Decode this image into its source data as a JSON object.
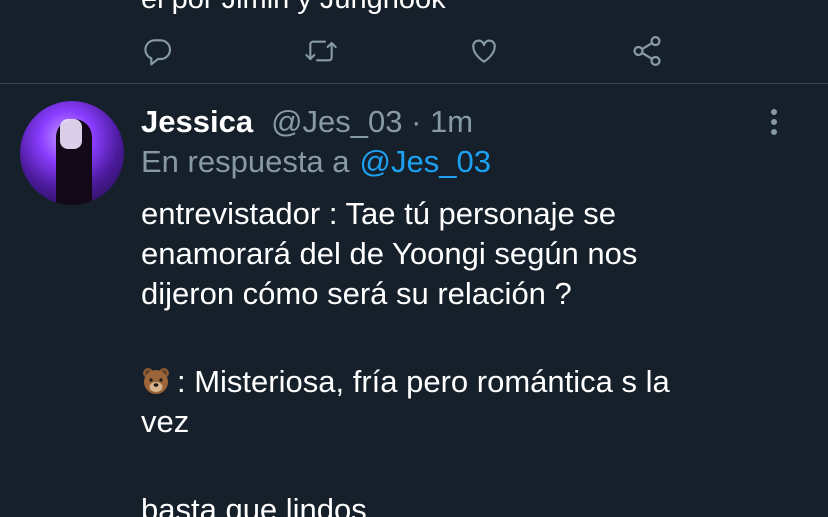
{
  "previous_tweet": {
    "text_partial": "el por Jimin y Junghook"
  },
  "actions": {
    "reply_icon": "reply-icon",
    "retweet_icon": "retweet-icon",
    "like_icon": "heart-icon",
    "share_icon": "share-icon"
  },
  "tweet": {
    "display_name": "Jessica",
    "handle_time": "@Jes_03 · 1m",
    "reply_prefix": "En respuesta a",
    "reply_handle": "@Jes_03",
    "line1": "entrevistador : Tae tú personaje se",
    "line2": "enamorará del de Yoongi según nos",
    "line3": "dijeron cómo será su relación ?",
    "line4": ": Misteriosa, fría pero romántica s la",
    "line5": "vez",
    "line6": "basta que lindos",
    "emoji": "bear-face-emoji",
    "more_icon": "more-vertical-icon"
  },
  "colors": {
    "background": "#15202b",
    "divider": "#38444d",
    "secondary_text": "#8899a6",
    "link": "#1da1f2"
  }
}
